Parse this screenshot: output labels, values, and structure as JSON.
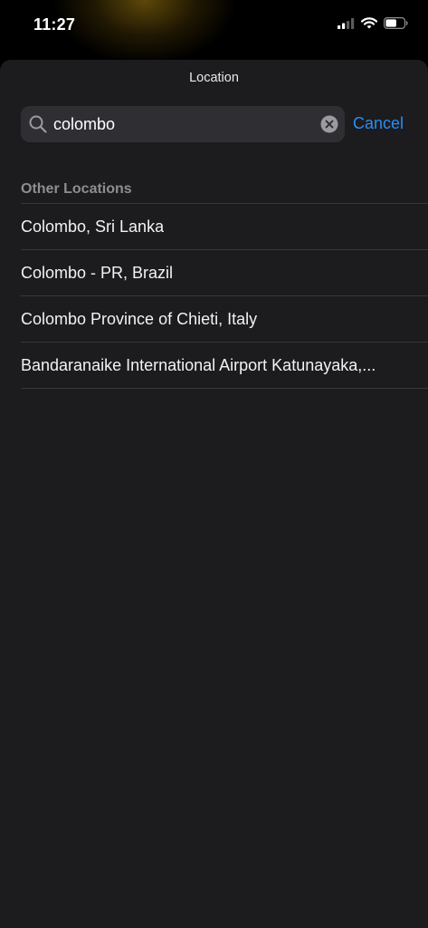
{
  "status_bar": {
    "time": "11:27",
    "icons": [
      "cellular-signal-icon",
      "wifi-icon",
      "battery-icon"
    ]
  },
  "sheet": {
    "title": "Location"
  },
  "search": {
    "value": "colombo",
    "icon": "search-icon",
    "clear_icon": "clear-icon",
    "cancel_label": "Cancel"
  },
  "results": {
    "section_header": "Other Locations",
    "items": [
      {
        "label": "Colombo, Sri Lanka"
      },
      {
        "label": "Colombo - PR, Brazil"
      },
      {
        "label": "Colombo Province of Chieti, Italy"
      },
      {
        "label": "Bandaranaike International Airport Katunayaka,..."
      }
    ]
  },
  "colors": {
    "background": "#000000",
    "sheet": "#1c1c1e",
    "search_field": "#2f2f33",
    "accent": "#2c8cf5",
    "secondary_text": "#8d8d93",
    "separator": "#38383c"
  }
}
